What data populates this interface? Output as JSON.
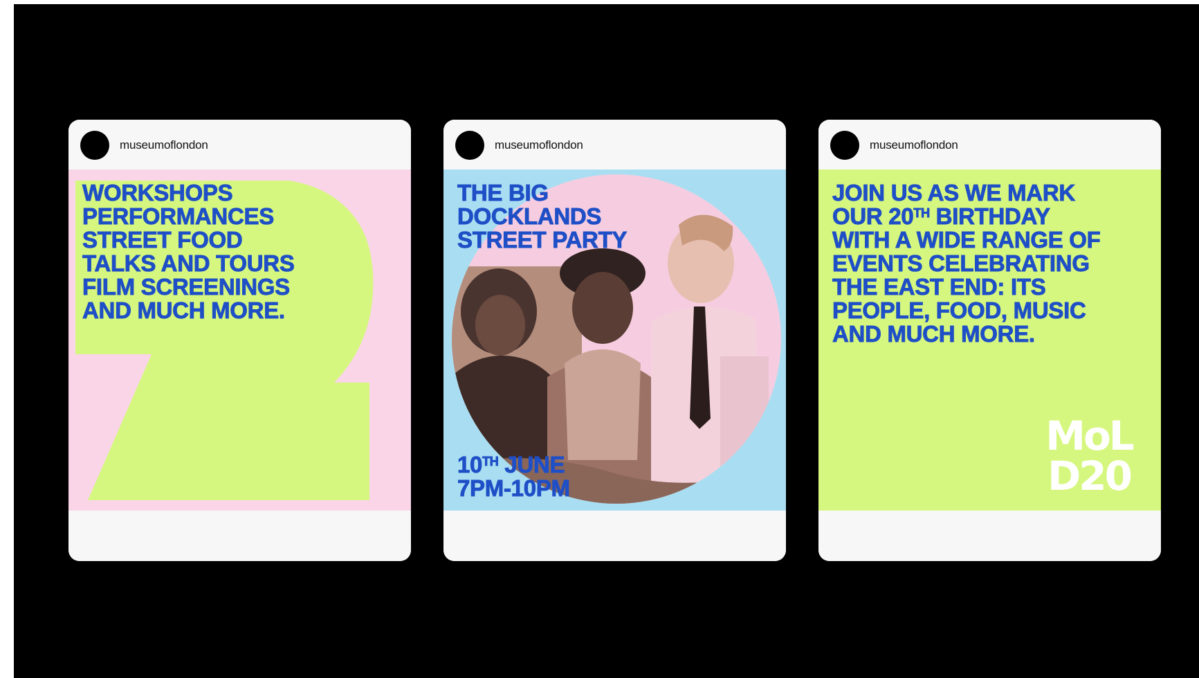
{
  "colors": {
    "page_background": "#000000",
    "card_background": "#f7f7f7",
    "pink": "#f9d5e7",
    "lime": "#d6f77f",
    "sky": "#a9def2",
    "photo_tone": "#b48d7c",
    "headline_blue": "#1f4fc6",
    "logo_white": "#ffffff"
  },
  "posts": [
    {
      "username": "museumoflondon",
      "avatar_icon": "profile-avatar-icon",
      "headline": "WORKSHOPS\nPERFORMANCES\nSTREET FOOD\nTALKS AND TOURS\nFILM SCREENINGS\nAND MUCH MORE."
    },
    {
      "username": "museumoflondon",
      "avatar_icon": "profile-avatar-icon",
      "headline": "THE BIG\nDOCKLANDS\nSTREET PARTY",
      "date_day": "10",
      "date_suffix": "TH",
      "date_month": " JUNE",
      "time": "7PM-10PM"
    },
    {
      "username": "museumoflondon",
      "avatar_icon": "profile-avatar-icon",
      "headline_line2_prefix": "OUR 20",
      "headline_line2_suffix": "TH",
      "headline_line2_rest": " BIRTHDAY",
      "headline_line1": "JOIN US AS WE MARK",
      "headline_rest": "WITH A WIDE RANGE OF\nEVENTS CELEBRATING\nTHE EAST END: ITS\nPEOPLE, FOOD, MUSIC\nAND MUCH MORE.",
      "logo_line1": "MoL",
      "logo_line2": "D20"
    }
  ]
}
